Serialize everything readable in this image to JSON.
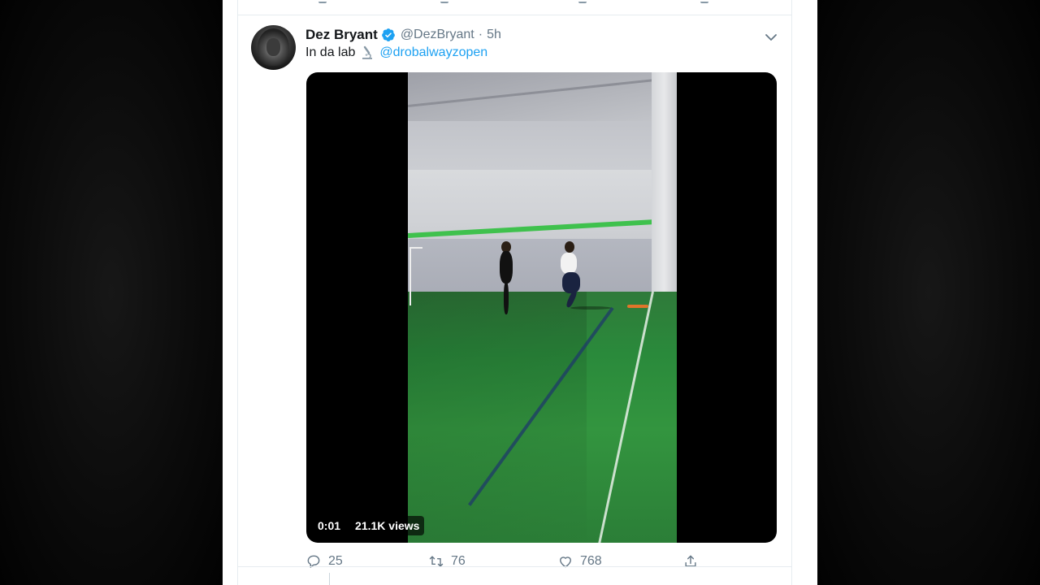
{
  "tweet": {
    "display_name": "Dez Bryant",
    "handle": "@DezBryant",
    "separator": "·",
    "time": "5h",
    "text_before": "In da lab",
    "mention": "@drobalwayzopen",
    "media": {
      "elapsed": "0:01",
      "views": "21.1K views"
    },
    "actions": {
      "replies": "25",
      "retweets": "76",
      "likes": "768"
    }
  },
  "colors": {
    "verified_badge": "#1da1f2",
    "mention": "#1da1f2",
    "muted": "#657786",
    "text": "#14171a"
  },
  "icons": {
    "verified": "verified-badge-icon",
    "microscope": "microscope-icon",
    "caret": "chevron-down-icon",
    "reply": "reply-icon",
    "retweet": "retweet-icon",
    "like": "heart-icon",
    "share": "share-icon"
  }
}
